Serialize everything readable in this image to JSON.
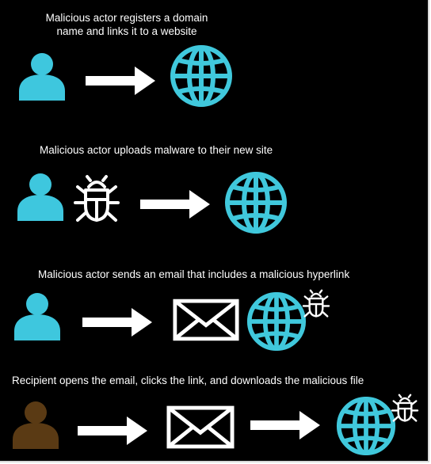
{
  "steps": [
    {
      "caption_line1": "Malicious actor registers a domain",
      "caption_line2": "name and links it to a website"
    },
    {
      "caption": "Malicious actor uploads malware to their new site"
    },
    {
      "caption": "Malicious actor sends an email that includes a malicious hyperlink"
    },
    {
      "caption": "Recipient opens the email, clicks the link, and downloads the malicious file"
    }
  ],
  "icons": {
    "actor": "person-icon",
    "recipient": "person-icon",
    "site": "globe-icon",
    "malware": "bug-icon",
    "email": "envelope-icon",
    "connector": "arrow-right-icon"
  },
  "colors": {
    "background": "#000000",
    "actor": "#3ec7de",
    "recipient": "#5a3a14",
    "globe": "#40c8dc",
    "icon_white": "#ffffff",
    "text": "#ffffff"
  }
}
